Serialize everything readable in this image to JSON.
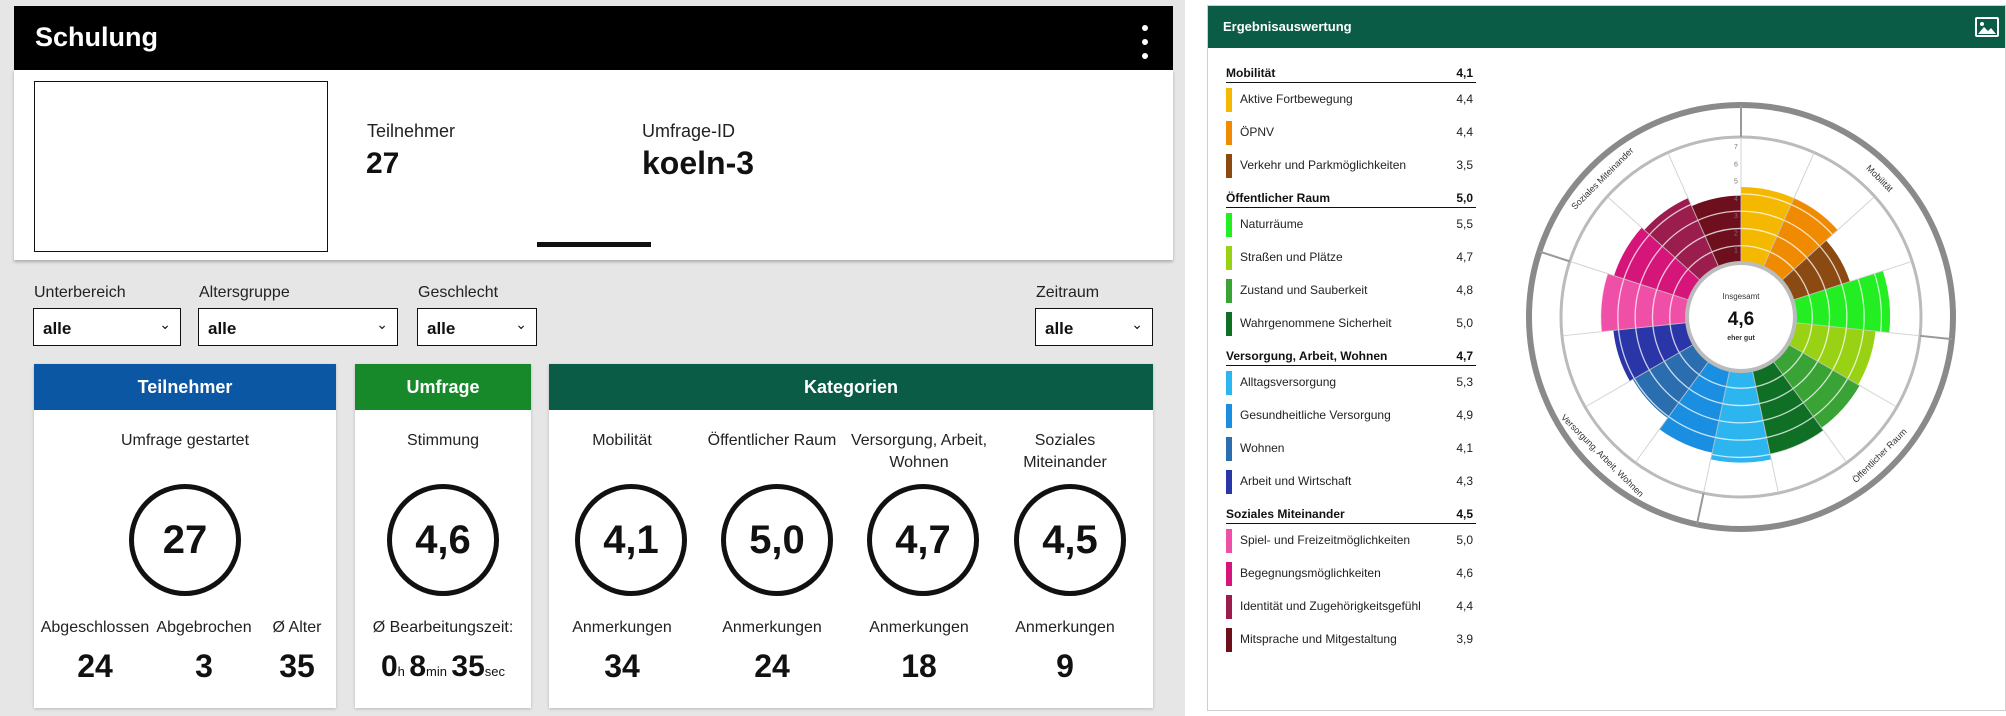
{
  "header": {
    "title": "Schulung"
  },
  "info": {
    "participants_label": "Teilnehmer",
    "participants_value": "27",
    "survey_id_label": "Umfrage-ID",
    "survey_id_value": "koeln-3"
  },
  "filters": {
    "unterbereich": {
      "label": "Unterbereich",
      "value": "alle"
    },
    "altersgruppe": {
      "label": "Altersgruppe",
      "value": "alle"
    },
    "geschlecht": {
      "label": "Geschlecht",
      "value": "alle"
    },
    "zeitraum": {
      "label": "Zeitraum",
      "value": "alle"
    }
  },
  "cards": {
    "teilnehmer": {
      "title": "Teilnehmer",
      "caption": "Umfrage gestartet",
      "value": "27",
      "completed_label": "Abgeschlossen",
      "completed": "24",
      "aborted_label": "Abgebrochen",
      "aborted": "3",
      "age_label": "Ø Alter",
      "age": "35"
    },
    "umfrage": {
      "title": "Umfrage",
      "caption": "Stimmung",
      "value": "4,6",
      "time_label": "Ø Bearbeitungszeit:",
      "hours": "0",
      "hours_unit": "h",
      "minutes": "8",
      "minutes_unit": "min",
      "seconds": "35",
      "seconds_unit": "sec"
    },
    "kategorien": {
      "title": "Kategorien",
      "items": [
        {
          "name": "Mobilität",
          "value": "4,1",
          "notes_label": "Anmerkungen",
          "notes": "34"
        },
        {
          "name": "Öffentlicher Raum",
          "value": "5,0",
          "notes_label": "Anmerkungen",
          "notes": "24"
        },
        {
          "name_line1": "Versorgung, Arbeit,",
          "name_line2": "Wohnen",
          "value": "4,7",
          "notes_label": "Anmerkungen",
          "notes": "18"
        },
        {
          "name_line1": "Soziales",
          "name_line2": "Miteinander",
          "value": "4,5",
          "notes_label": "Anmerkungen",
          "notes": "9"
        }
      ]
    }
  },
  "results": {
    "title": "Ergebnisauswertung",
    "groups": [
      {
        "name": "Mobilität",
        "value": "4,1",
        "items": [
          {
            "name": "Aktive Fortbewegung",
            "value": "4,4",
            "color": "#f5b800"
          },
          {
            "name": "ÖPNV",
            "value": "4,4",
            "color": "#f08a00"
          },
          {
            "name": "Verkehr und Parkmöglichkeiten",
            "value": "3,5",
            "color": "#8b4a12"
          }
        ]
      },
      {
        "name": "Öffentlicher Raum",
        "value": "5,0",
        "items": [
          {
            "name": "Naturräume",
            "value": "5,5",
            "color": "#22ee22"
          },
          {
            "name": "Straßen und Plätze",
            "value": "4,7",
            "color": "#99d214"
          },
          {
            "name": "Zustand und Sauberkeit",
            "value": "4,8",
            "color": "#3aa335"
          },
          {
            "name": "Wahrgenommene Sicherheit",
            "value": "5,0",
            "color": "#0f6f25"
          }
        ]
      },
      {
        "name": "Versorgung, Arbeit, Wohnen",
        "value": "4,7",
        "items": [
          {
            "name": "Alltagsversorgung",
            "value": "5,3",
            "color": "#2cb5ee"
          },
          {
            "name": "Gesundheitliche Versorgung",
            "value": "4,9",
            "color": "#1a8ee0"
          },
          {
            "name": "Wohnen",
            "value": "4,1",
            "color": "#2a6eb0"
          },
          {
            "name": "Arbeit und Wirtschaft",
            "value": "4,3",
            "color": "#2a35a8"
          }
        ]
      },
      {
        "name": "Soziales Miteinander",
        "value": "4,5",
        "items": [
          {
            "name": "Spiel- und Freizeitmöglichkeiten",
            "value": "5,0",
            "color": "#ef4fa6"
          },
          {
            "name": "Begegnungsmöglichkeiten",
            "value": "4,6",
            "color": "#d6157a"
          },
          {
            "name": "Identität und Zugehörigkeitsgefühl",
            "value": "4,4",
            "color": "#9a1d4e"
          },
          {
            "name": "Mitsprache und Mitgestaltung",
            "value": "3,9",
            "color": "#6e0f1e"
          }
        ]
      }
    ],
    "center_label": "Insgesamt",
    "center_value": "4,6",
    "center_rating": "eher gut",
    "ring_labels": [
      "Mobilität",
      "Öffentlicher Raum",
      "Versorgung, Arbeit, Wohnen",
      "Soziales Miteinander"
    ],
    "scale_ticks": [
      "1",
      "2",
      "3",
      "4",
      "5",
      "6",
      "7"
    ],
    "scale_max": 7
  },
  "colors": {
    "teilnehmer": "#0b57a3",
    "umfrage": "#17892b",
    "kategorien": "#0a5c46",
    "results_header": "#0a5c46"
  }
}
